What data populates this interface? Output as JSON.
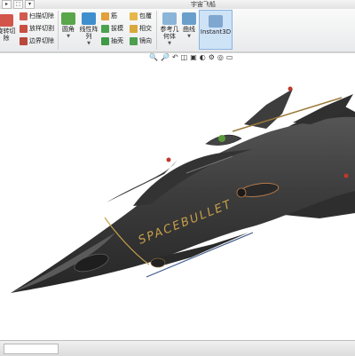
{
  "window": {
    "title": "宇宙飞船"
  },
  "quick_access": [
    "▸",
    "⬚",
    "▾"
  ],
  "ribbon": {
    "col1": [
      "扫描切除",
      "放样切割",
      "边界切除"
    ],
    "col0": [
      "旋转切",
      "除"
    ],
    "col2": [
      "圆角",
      "线性阵列"
    ],
    "col3": [
      "筋",
      "拔模",
      "抽壳"
    ],
    "col4": [
      "包覆",
      "相交",
      "镜向"
    ],
    "refgeo": "参考几何体",
    "curves": "曲线",
    "instant3d": "Instant3D"
  },
  "view_toolbar": [
    "🔍",
    "🔎",
    "↶",
    "◫",
    "▣",
    "◐",
    "⚙",
    "◎",
    "▭"
  ],
  "model": {
    "label": "SPACEBULLET"
  },
  "colors": {
    "hull": "#3a3a3a",
    "accent": "#c8a04a",
    "ribbon_bg": "#eceded",
    "highlight": "#cfe3f7"
  }
}
